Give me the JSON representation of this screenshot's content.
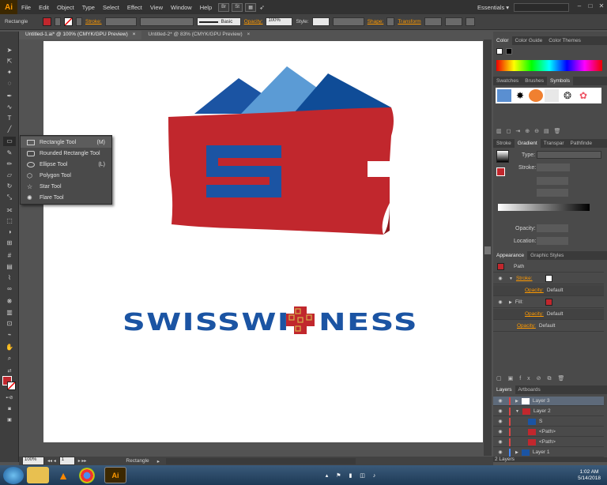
{
  "menubar": {
    "app_icon": "Ai",
    "items": [
      "File",
      "Edit",
      "Object",
      "Type",
      "Select",
      "Effect",
      "View",
      "Window",
      "Help"
    ],
    "buttons": [
      "Br",
      "St"
    ],
    "workspace": "Essentials",
    "window_controls": [
      "–",
      "□",
      "✕"
    ]
  },
  "controlbar": {
    "selection_label": "Rectangle",
    "stroke_label": "Stroke:",
    "brush_label": "Basic",
    "opacity_label": "Opacity:",
    "opacity_value": "100%",
    "style_label": "Style:",
    "shape_label": "Shape:",
    "transform_label": "Transform",
    "fill_color": "#c1272d"
  },
  "doctabs": [
    {
      "label": "Untitled-1.ai* @ 100% (CMYK/GPU Preview)",
      "close": "×"
    },
    {
      "label": "Untitled-2* @ 83% (CMYK/GPU Preview)",
      "close": "×"
    }
  ],
  "flyout": {
    "items": [
      {
        "label": "Rectangle Tool",
        "shortcut": "(M)"
      },
      {
        "label": "Rounded Rectangle Tool",
        "shortcut": ""
      },
      {
        "label": "Ellipse Tool",
        "shortcut": "(L)"
      },
      {
        "label": "Polygon Tool",
        "shortcut": ""
      },
      {
        "label": "Star Tool",
        "shortcut": ""
      },
      {
        "label": "Flare Tool",
        "shortcut": ""
      }
    ]
  },
  "artwork": {
    "logo_letter": "S",
    "wordmark_left": "SWISSWI",
    "wordmark_right": "NESS",
    "colors": {
      "red": "#c1272d",
      "blue": "#1b54a3",
      "mid_blue": "#5b9bd5",
      "dark_blue": "#0f4c97"
    }
  },
  "panels": {
    "color_tabs": [
      "Color",
      "Color Guide",
      "Color Themes"
    ],
    "swatch_tabs": [
      "Swatches",
      "Brushes",
      "Symbols"
    ],
    "stroke_tabs": [
      "Stroke",
      "Gradient",
      "Transpar",
      "Pathfinde"
    ],
    "gradient": {
      "type_label": "Type:",
      "stroke_label": "Stroke:",
      "opacity_label": "Opacity:",
      "location_label": "Location:"
    },
    "appearance_tabs": [
      "Appearance",
      "Graphic Styles"
    ],
    "appearance": {
      "path_label": "Path",
      "stroke_label": "Stroke:",
      "fill_label": "Fill:",
      "opacity_label": "Opacity:",
      "default_value": "Default"
    },
    "layers_tabs": [
      "Layers",
      "Artboards"
    ],
    "layers": [
      {
        "name": "Layer 3",
        "indent": 0
      },
      {
        "name": "Layer 2",
        "indent": 0
      },
      {
        "name": "S",
        "indent": 1
      },
      {
        "name": "<Path>",
        "indent": 1
      },
      {
        "name": "<Path>",
        "indent": 1
      },
      {
        "name": "Layer 1",
        "indent": 0
      }
    ],
    "layers_count": "2 Layers"
  },
  "statusbar": {
    "zoom": "100%",
    "artboard_num": "1",
    "tool_name": "Rectangle"
  },
  "taskbar": {
    "time": "1:02 AM",
    "date": "5/14/2018",
    "ai_label": "Ai"
  }
}
